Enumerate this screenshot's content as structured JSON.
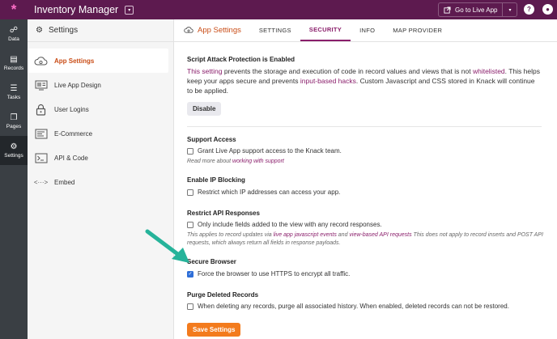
{
  "topbar": {
    "logo": "*",
    "title": "Inventory Manager",
    "title_caret": "▾",
    "live_label": "Go to Live App",
    "live_caret": "▾",
    "help": "?",
    "user": "●"
  },
  "rail": [
    {
      "icon": "☍",
      "label": "Data"
    },
    {
      "icon": "▤",
      "label": "Records"
    },
    {
      "icon": "☰",
      "label": "Tasks"
    },
    {
      "icon": "❐",
      "label": "Pages"
    },
    {
      "icon": "⚙",
      "label": "Settings"
    }
  ],
  "sidebar": {
    "title": "Settings",
    "items": [
      {
        "label": "App Settings"
      },
      {
        "label": "Live App Design"
      },
      {
        "label": "User Logins"
      },
      {
        "label": "E-Commerce"
      },
      {
        "label": "API & Code"
      },
      {
        "label": "Embed"
      }
    ]
  },
  "tabs": {
    "title": "App Settings",
    "items": [
      {
        "label": "SETTINGS"
      },
      {
        "label": "SECURITY"
      },
      {
        "label": "INFO"
      },
      {
        "label": "MAP PROVIDER"
      }
    ]
  },
  "security": {
    "script": {
      "heading": "Script Attack Protection is Enabled",
      "link1": "This setting",
      "text1": " prevents the storage and execution of code in record values and views that is not ",
      "link2": "whitelisted",
      "text2": ". This helps keep your apps secure and prevents ",
      "link3": "input-based hacks",
      "text3": ". Custom Javascript and CSS stored in Knack will continue to be applied.",
      "button": "Disable"
    },
    "support": {
      "heading": "Support Access",
      "checkbox": "Grant Live App support access to the Knack team.",
      "note_prefix": "Read more about ",
      "note_link": "working with support"
    },
    "ip": {
      "heading": "Enable IP Blocking",
      "checkbox": "Restrict which IP addresses can access your app."
    },
    "api": {
      "heading": "Restrict API Responses",
      "checkbox": "Only include fields added to the view with any record responses.",
      "note_prefix": "This applies to record updates via ",
      "note_link1": "live app javascript events",
      "note_mid": " and ",
      "note_link2": "view-based API requests",
      "note_suffix": " This does not apply to record inserts and POST API requests, which always return all fields in response payloads."
    },
    "secure": {
      "heading": "Secure Browser",
      "checkbox": "Force the browser to use HTTPS to encrypt all traffic.",
      "checked": true
    },
    "purge": {
      "heading": "Purge Deleted Records",
      "checkbox": "When deleting any records, purge all associated history. When enabled, deleted records can not be restored."
    },
    "save": "Save Settings"
  },
  "colors": {
    "topbar": "#5d1a4f",
    "accent_orange": "#c94d17",
    "link_purple": "#8a1e6b",
    "save_button": "#f37b1d",
    "arrow": "#26b39a"
  }
}
